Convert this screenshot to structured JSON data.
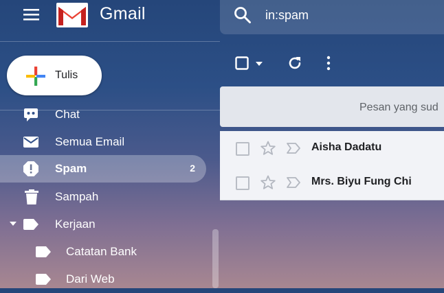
{
  "app": {
    "name": "Gmail",
    "brand_colors": {
      "red": "#EA4335",
      "blue": "#4285F4",
      "yellow": "#FBBC04",
      "green": "#34A853"
    }
  },
  "header": {
    "menu_icon": "hamburger-icon",
    "search": {
      "icon": "search-icon",
      "value": "in:spam"
    }
  },
  "compose": {
    "label": "Tulis",
    "icon": "plus-icon"
  },
  "sidebar": {
    "items": [
      {
        "label": "Chat",
        "icon": "chat-icon"
      },
      {
        "label": "Semua Email",
        "icon": "mail-icon"
      },
      {
        "label": "Spam",
        "icon": "spam-icon",
        "count": "2",
        "active": true
      },
      {
        "label": "Sampah",
        "icon": "trash-icon"
      },
      {
        "label": "Kerjaan",
        "icon": "label-icon",
        "expandable": true
      },
      {
        "label": "Catatan Bank",
        "icon": "label-icon"
      },
      {
        "label": "Dari Web",
        "icon": "label-icon"
      }
    ]
  },
  "toolbar": {
    "select_icon": "checkbox-icon",
    "refresh_icon": "refresh-icon",
    "more_icon": "more-vert-icon"
  },
  "notice": {
    "text": "Pesan yang sud"
  },
  "messages": [
    {
      "sender": "Aisha Dadatu"
    },
    {
      "sender": "Mrs. Biyu Fung Chi"
    }
  ]
}
